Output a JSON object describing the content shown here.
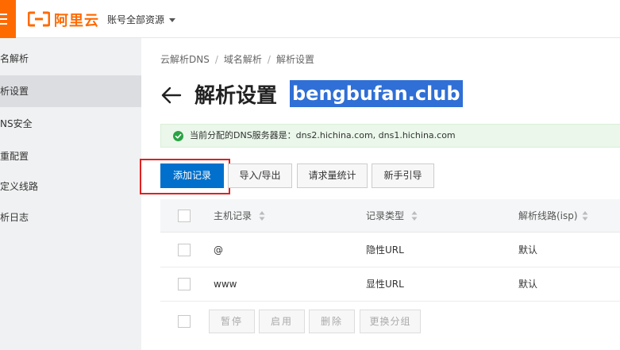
{
  "header": {
    "logo_text": "阿里云",
    "resource_switch": "账号全部资源"
  },
  "sidebar": {
    "title": "名解析",
    "items": [
      {
        "label": "析设置",
        "active": true
      },
      {
        "label": "NS安全",
        "active": false
      },
      {
        "label": "重配置",
        "active": false
      },
      {
        "label": "定义线路",
        "active": false
      },
      {
        "label": "析日志",
        "active": false
      }
    ]
  },
  "breadcrumb": {
    "items": [
      "云解析DNS",
      "域名解析",
      "解析设置"
    ],
    "separator": "/"
  },
  "page": {
    "title": "解析设置",
    "domain": "bengbufan.club"
  },
  "alert": {
    "text": "当前分配的DNS服务器是：dns2.hichina.com, dns1.hichina.com"
  },
  "toolbar": {
    "add_record": "添加记录",
    "import_export": "导入/导出",
    "request_stats": "请求量统计",
    "beginner_guide": "新手引导"
  },
  "table": {
    "columns": [
      "主机记录",
      "记录类型",
      "解析线路(isp)"
    ],
    "rows": [
      {
        "host": "@",
        "type": "隐性URL",
        "line": "默认"
      },
      {
        "host": "www",
        "type": "显性URL",
        "line": "默认"
      }
    ]
  },
  "batch": {
    "pause": "暂停",
    "enable": "启用",
    "delete": "删除",
    "change_group": "更换分组"
  },
  "colors": {
    "brand_orange": "#ff6a00",
    "primary_blue": "#0070cc",
    "highlight_red": "#e02020",
    "domain_highlight": "#2f6fd6",
    "alert_green": "#2ba245"
  },
  "icons": [
    "menu-icon",
    "aliyun-logo-icon",
    "chevron-down-icon",
    "back-arrow-icon",
    "check-circle-icon",
    "sort-icon"
  ]
}
